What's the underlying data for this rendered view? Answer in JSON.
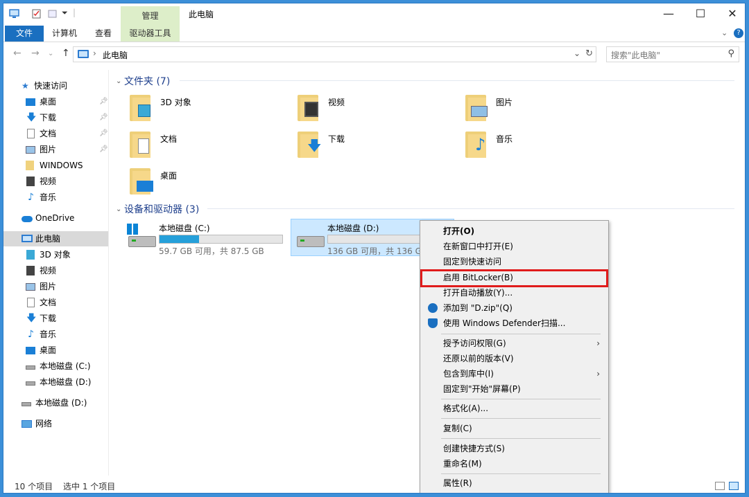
{
  "window": {
    "title": "此电脑",
    "context_tab": "管理",
    "controls": {
      "minimize": "—",
      "maximize": "☐",
      "close": "✕"
    }
  },
  "ribbon": {
    "tabs": [
      "文件",
      "计算机",
      "查看",
      "驱动器工具"
    ]
  },
  "address": {
    "path": "此电脑",
    "search_placeholder": "搜索\"此电脑\""
  },
  "sidebar": {
    "quick_access": "快速访问",
    "quick_items": [
      "桌面",
      "下载",
      "文档",
      "图片",
      "WINDOWS",
      "视频",
      "音乐"
    ],
    "onedrive": "OneDrive",
    "this_pc": "此电脑",
    "pc_items": [
      "3D 对象",
      "视频",
      "图片",
      "文档",
      "下载",
      "音乐",
      "桌面",
      "本地磁盘 (C:)",
      "本地磁盘 (D:)"
    ],
    "drive_d": "本地磁盘 (D:)",
    "network": "网络"
  },
  "folders": {
    "header": "文件夹 (7)",
    "items": [
      "3D 对象",
      "视频",
      "图片",
      "文档",
      "下载",
      "音乐",
      "桌面"
    ]
  },
  "drives": {
    "header": "设备和驱动器 (3)",
    "items": [
      {
        "name": "本地磁盘 (C:)",
        "info": "59.7 GB 可用，共 87.5 GB",
        "used_fraction": 0.32
      },
      {
        "name": "本地磁盘 (D:)",
        "info": "136 GB 可用，共 136 GB",
        "used_fraction": 0.0
      }
    ]
  },
  "context_menu": {
    "items": [
      "打开(O)",
      "在新窗口中打开(E)",
      "固定到快速访问",
      "启用 BitLocker(B)",
      "打开自动播放(Y)...",
      "添加到 \"D.zip\"(Q)",
      "使用 Windows Defender扫描...",
      "授予访问权限(G)",
      "还原以前的版本(V)",
      "包含到库中(I)",
      "固定到\"开始\"屏幕(P)",
      "格式化(A)...",
      "复制(C)",
      "创建快捷方式(S)",
      "重命名(M)",
      "属性(R)"
    ],
    "highlighted": "启用 BitLocker(B)"
  },
  "status": {
    "count": "10 个项目",
    "selected": "选中 1 个项目"
  },
  "colors": {
    "accent": "#1a6fc0",
    "highlight_border": "#e01b1b",
    "manage_tab": "#ddeec9"
  }
}
